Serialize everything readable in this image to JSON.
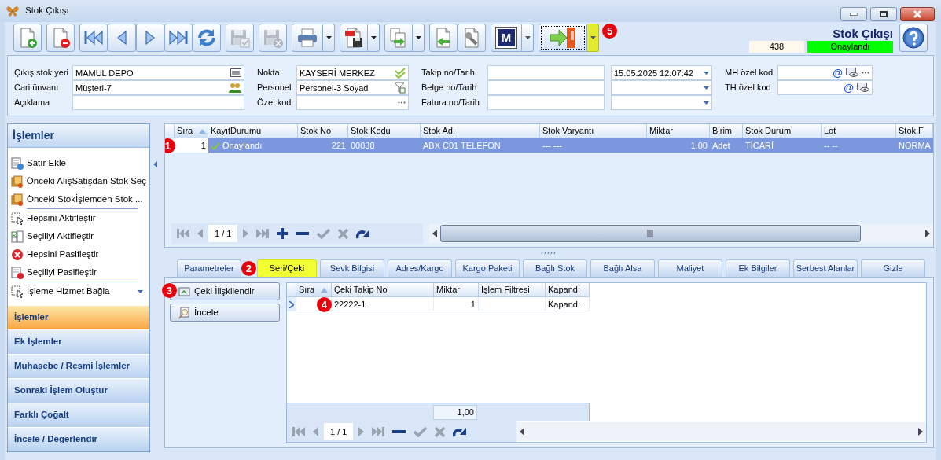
{
  "window": {
    "title": "Stok Çıkışı"
  },
  "toolbar": [
    {
      "kind": "new",
      "disabled": false,
      "dropdown": false,
      "highlighted": false
    },
    {
      "kind": "delete",
      "disabled": false,
      "dropdown": false,
      "highlighted": false
    },
    {
      "kind": "first",
      "disabled": false,
      "dropdown": false,
      "highlighted": false
    },
    {
      "kind": "prev",
      "disabled": false,
      "dropdown": false,
      "highlighted": false
    },
    {
      "kind": "next",
      "disabled": false,
      "dropdown": false,
      "highlighted": false
    },
    {
      "kind": "last",
      "disabled": false,
      "dropdown": false,
      "highlighted": false
    },
    {
      "kind": "refresh",
      "disabled": false,
      "dropdown": false,
      "highlighted": false
    },
    {
      "kind": "save",
      "disabled": true,
      "dropdown": false,
      "highlighted": false
    },
    {
      "kind": "cancel",
      "disabled": true,
      "dropdown": false,
      "highlighted": false
    },
    {
      "kind": "print",
      "disabled": false,
      "dropdown": true,
      "highlighted": false
    },
    {
      "kind": "pdf",
      "disabled": false,
      "dropdown": true,
      "highlighted": false
    },
    {
      "kind": "copy",
      "disabled": false,
      "dropdown": true,
      "highlighted": false
    },
    {
      "kind": "import",
      "disabled": false,
      "dropdown": false,
      "highlighted": false
    },
    {
      "kind": "tools",
      "disabled": false,
      "dropdown": false,
      "highlighted": false
    },
    {
      "kind": "logo",
      "label": "M",
      "disabled": false,
      "dropdown": true,
      "highlighted": false
    },
    {
      "kind": "exit",
      "disabled": false,
      "dropdown": true,
      "highlighted": true,
      "marker": "5"
    }
  ],
  "header": {
    "title": "Stok Çıkışı",
    "number": "438",
    "status": "Onaylandı"
  },
  "form": {
    "columns": [
      {
        "fields": [
          {
            "kind": "text",
            "label": "Çıkış stok yeri",
            "value": "MAMUL DEPO",
            "buttons": [
              {
                "kind": "barcode"
              }
            ]
          },
          {
            "kind": "text",
            "label": "Cari ünvanı",
            "value": "Müşteri-7",
            "buttons": [
              {
                "kind": "people"
              }
            ]
          },
          {
            "kind": "text",
            "label": "Açıklama"
          }
        ]
      },
      {
        "fields": [
          {
            "kind": "text",
            "label": "Nokta",
            "value": "KAYSERİ MERKEZ",
            "buttons": [
              {
                "kind": "check"
              }
            ]
          },
          {
            "kind": "text",
            "label": "Personel",
            "value": "Personel-3 Soyad",
            "buttons": [
              {
                "kind": "filter"
              }
            ]
          },
          {
            "kind": "text",
            "label": "Özel kod",
            "buttons": [
              {
                "kind": "ellipsis"
              }
            ]
          }
        ]
      },
      {
        "fields": [
          {
            "kind": "text-date",
            "label": "Takip no/Tarih",
            "date_value": "15.05.2025 12:07:42"
          },
          {
            "kind": "text-date",
            "label": "Belge no/Tarih"
          },
          {
            "kind": "text-date",
            "label": "Fatura no/Tarih"
          }
        ]
      },
      {
        "fields": [
          {
            "kind": "text",
            "label": "MH özel kod",
            "buttons": [
              {
                "kind": "text",
                "text": "@"
              },
              {
                "kind": "eye"
              },
              {
                "kind": "ellipsis"
              }
            ]
          },
          {
            "kind": "text",
            "label": "TH özel kod",
            "buttons": [
              {
                "kind": "text",
                "text": "@"
              },
              {
                "kind": "eye"
              }
            ]
          }
        ]
      }
    ]
  },
  "sidebar": {
    "title": "İşlemler",
    "sections": [
      [
        {
          "kind": "add-row",
          "label": "Satır Ekle"
        },
        {
          "kind": "pick",
          "label": "Önceki AlışSatışdan Stok Seç"
        },
        {
          "kind": "pick",
          "label": "Önceki Stokİşlemden Stok ..."
        }
      ],
      [
        {
          "kind": "activate-all",
          "label": "Hepsini Aktifleştir"
        },
        {
          "kind": "activate-one",
          "label": "Seçiliyi Aktifleştir"
        },
        {
          "kind": "deactivate-all",
          "label": "Hepsini Pasifleştir"
        },
        {
          "kind": "deactivate-one",
          "label": "Seçiliyi Pasifleştir"
        }
      ],
      [
        {
          "kind": "bind",
          "label": "İşleme Hizmet Bağla"
        }
      ]
    ],
    "groups": [
      {
        "label": "İşlemler",
        "selected": true
      },
      {
        "label": "Ek İşlemler",
        "selected": false
      },
      {
        "label": "Muhasebe / Resmi İşlemler",
        "selected": false
      },
      {
        "label": "Sonraki İşlem Oluştur",
        "selected": false
      },
      {
        "label": "Farklı Çoğalt",
        "selected": false
      },
      {
        "label": "İncele / Değerlendir",
        "selected": false
      }
    ]
  },
  "grid": {
    "columns": [
      {
        "label": "Sıra",
        "sorted": true
      },
      {
        "label": "KayıtDurumu",
        "sorted": false
      },
      {
        "label": "Stok No",
        "sorted": false
      },
      {
        "label": "Stok Kodu",
        "sorted": false
      },
      {
        "label": "Stok Adı",
        "sorted": false
      },
      {
        "label": "Stok Varyantı",
        "sorted": false
      },
      {
        "label": "Miktar",
        "sorted": false
      },
      {
        "label": "Birim",
        "sorted": false
      },
      {
        "label": "Stok Durum",
        "sorted": false
      },
      {
        "label": "Lot",
        "sorted": false
      },
      {
        "label": "Stok F",
        "sorted": false
      }
    ],
    "rows": [
      {
        "selected": true,
        "marker": "1",
        "approved": true,
        "cells": [
          "1",
          "Onaylandı",
          "221",
          "00038",
          "ABX C01 TELEFON",
          "--- ---",
          "1,00",
          "Adet",
          "TİCARİ",
          "-- --",
          "NORMA"
        ]
      }
    ],
    "navigator": {
      "page": "1 / 1",
      "buttons": [
        {
          "kind": "first",
          "disabled": true
        },
        {
          "kind": "prev",
          "disabled": true
        },
        {
          "kind": "next",
          "disabled": true
        },
        {
          "kind": "last",
          "disabled": true
        },
        {
          "kind": "add",
          "disabled": false
        },
        {
          "kind": "remove",
          "disabled": false
        },
        {
          "kind": "confirm",
          "disabled": true
        },
        {
          "kind": "discard",
          "disabled": true
        },
        {
          "kind": "redo",
          "disabled": false
        }
      ]
    }
  },
  "tabs": [
    {
      "label": "Parametreler",
      "selected": false
    },
    {
      "label": "Seri/Çeki",
      "selected": true,
      "marker": "2"
    },
    {
      "label": "Sevk Bilgisi",
      "selected": false
    },
    {
      "label": "Adres/Kargo",
      "selected": false
    },
    {
      "label": "Kargo Paketi",
      "selected": false
    },
    {
      "label": "Bağlı Stok",
      "selected": false
    },
    {
      "label": "Bağlı Alsa",
      "selected": false
    },
    {
      "label": "Maliyet",
      "selected": false
    },
    {
      "label": "Ek Bilgiler",
      "selected": false
    },
    {
      "label": "Serbest Alanlar",
      "selected": false
    },
    {
      "label": "Gizle",
      "selected": false
    }
  ],
  "serial": {
    "buttons": [
      {
        "kind": "link",
        "label": "Çeki İlişkilendir",
        "marker": "3"
      },
      {
        "kind": "inspect",
        "label": "İncele"
      }
    ],
    "columns": [
      {
        "label": "Sıra",
        "sorted": true
      },
      {
        "label": "Çeki Takip No",
        "sorted": false
      },
      {
        "label": "Miktar",
        "sorted": false
      },
      {
        "label": "İşlem Filtresi",
        "sorted": false
      },
      {
        "label": "Kapandı",
        "sorted": false
      }
    ],
    "rows": [
      {
        "selected": true,
        "marker": "4",
        "cells": [
          null,
          "22222-1",
          "1",
          null,
          "Kapandı"
        ]
      }
    ],
    "total": "1,00",
    "navigator": {
      "page": "1 / 1",
      "buttons": [
        {
          "kind": "first",
          "disabled": true
        },
        {
          "kind": "prev",
          "disabled": true
        },
        {
          "kind": "next",
          "disabled": true
        },
        {
          "kind": "last",
          "disabled": true
        },
        {
          "kind": "remove",
          "disabled": false
        },
        {
          "kind": "confirm",
          "disabled": true
        },
        {
          "kind": "discard",
          "disabled": true
        },
        {
          "kind": "redo",
          "disabled": false
        }
      ]
    }
  }
}
